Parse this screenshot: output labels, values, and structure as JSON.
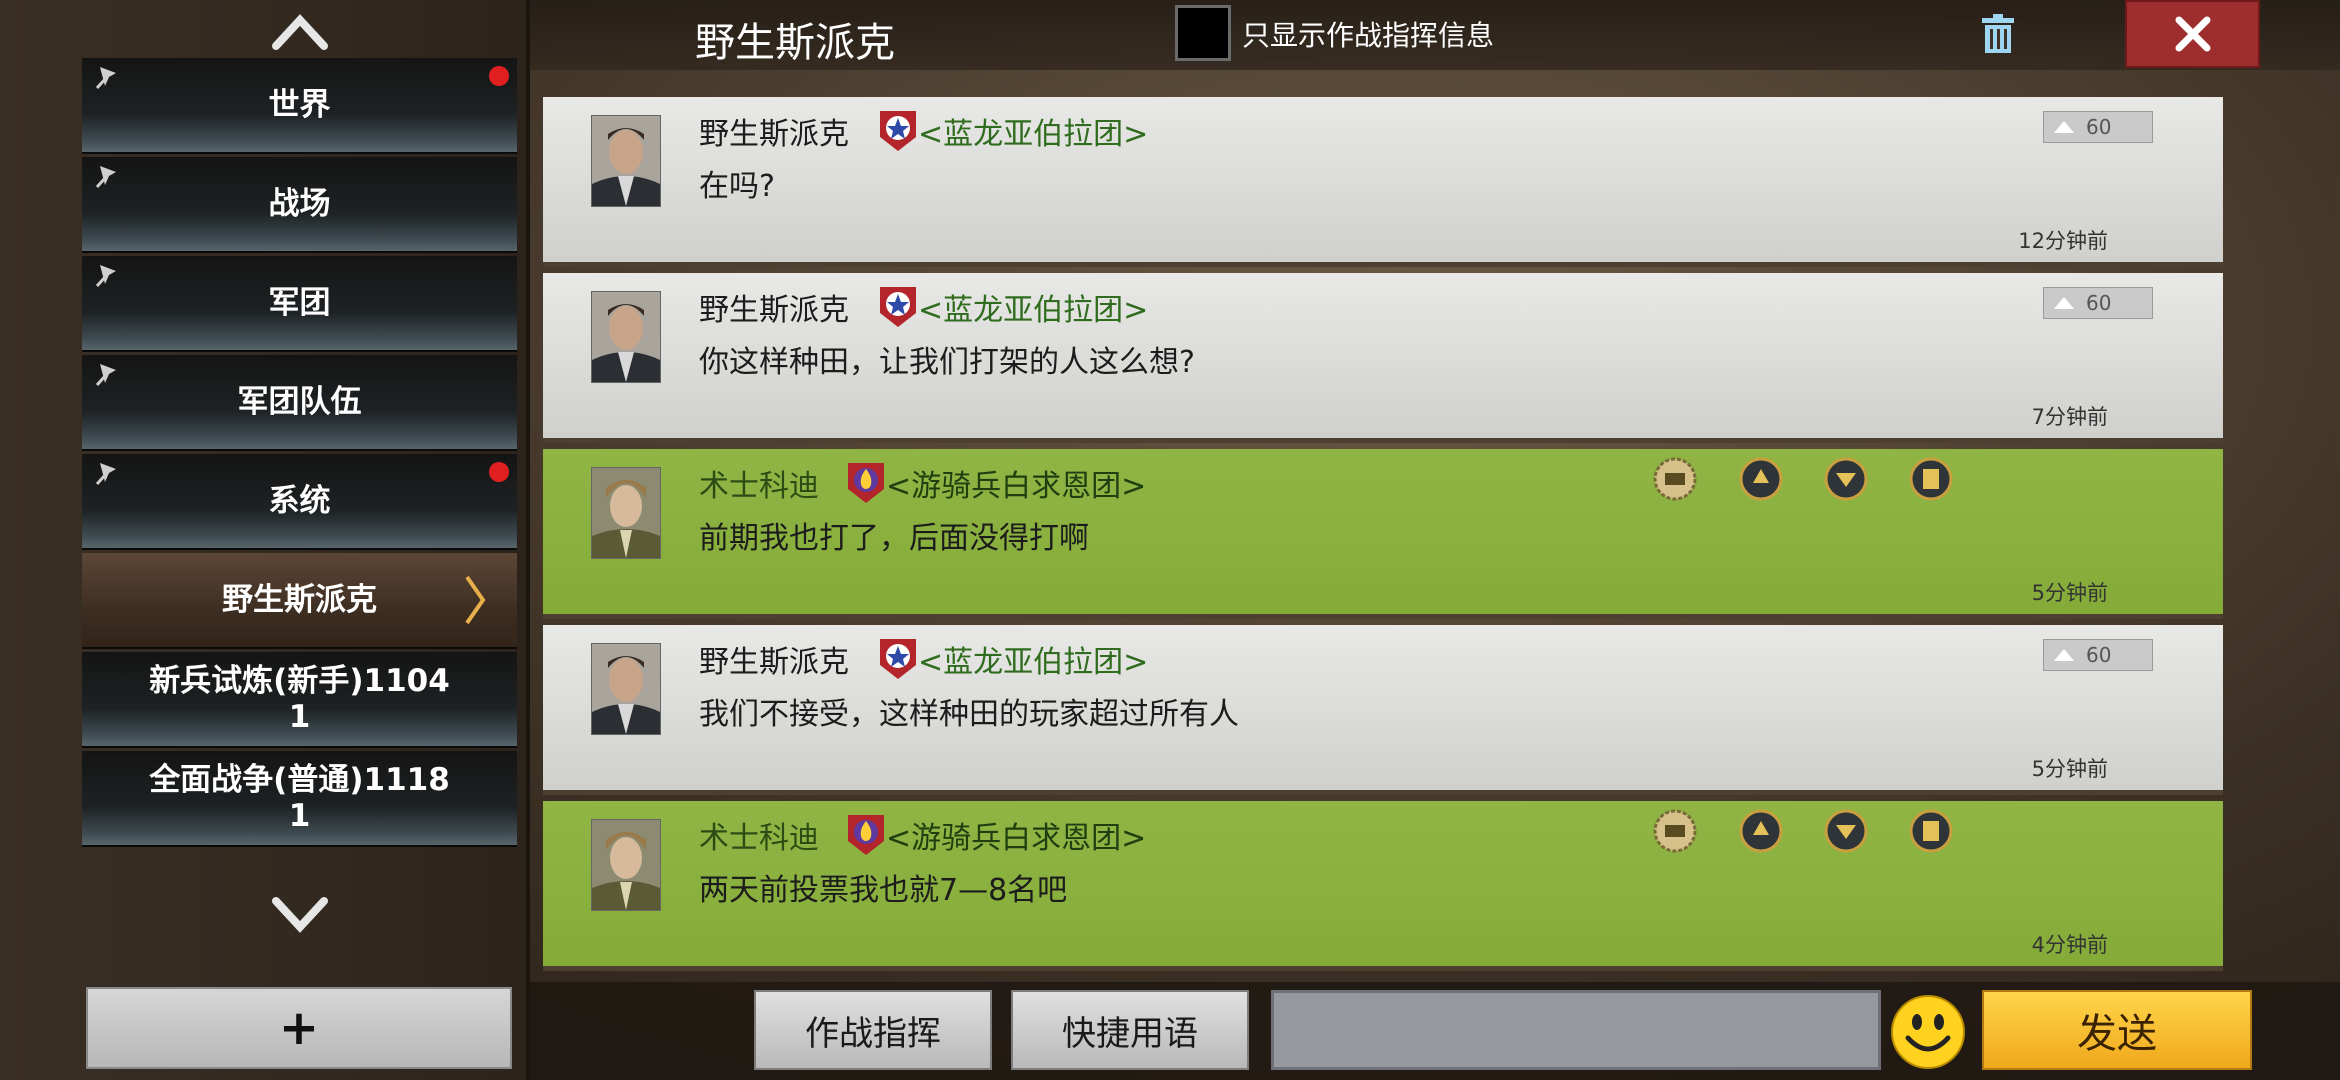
{
  "sidebar": {
    "channels": [
      {
        "label": "世界",
        "notify": true
      },
      {
        "label": "战场",
        "notify": false
      },
      {
        "label": "军团",
        "notify": false
      },
      {
        "label": "军团队伍",
        "notify": false
      },
      {
        "label": "系统",
        "notify": true
      }
    ],
    "active_channel": "野生斯派克",
    "rooms": [
      {
        "line1": "新兵试炼(新手)1104",
        "line2": "1"
      },
      {
        "line1": "全面战争(普通)1118",
        "line2": "1"
      }
    ],
    "add_label": "+"
  },
  "header": {
    "title": "野生斯派克",
    "filter_label": "只显示作战指挥信息"
  },
  "messages": [
    {
      "name": "野生斯派克",
      "clan": "<蓝龙亚伯拉团>",
      "text": "在吗?",
      "time": "12分钟前",
      "likes": "60",
      "style": "gray",
      "badge": "star"
    },
    {
      "name": "野生斯派克",
      "clan": "<蓝龙亚伯拉团>",
      "text": "你这样种田，让我们打架的人这么想?",
      "time": "7分钟前",
      "likes": "60",
      "style": "gray",
      "badge": "star"
    },
    {
      "name": "术士科迪",
      "clan": "<游骑兵白求恩团>",
      "text": "前期我也打了，后面没得打啊",
      "time": "5分钟前",
      "style": "green",
      "badge": "flame"
    },
    {
      "name": "野生斯派克",
      "clan": "<蓝龙亚伯拉团>",
      "text": "我们不接受，这样种田的玩家超过所有人",
      "time": "5分钟前",
      "likes": "60",
      "style": "gray",
      "badge": "star"
    },
    {
      "name": "术士科迪",
      "clan": "<游骑兵白求恩团>",
      "text": "两天前投票我也就7—8名吧",
      "time": "4分钟前",
      "style": "green",
      "badge": "flame"
    }
  ],
  "bottom": {
    "command_label": "作战指挥",
    "quick_label": "快捷用语",
    "input_value": "",
    "send_label": "发送"
  },
  "colors": {
    "gray_message": "#d9d9d7",
    "green_message": "#8ab13e",
    "close_button": "#9e2e2e",
    "send_button": "#f5bf30",
    "notify_dot": "#e02020"
  }
}
